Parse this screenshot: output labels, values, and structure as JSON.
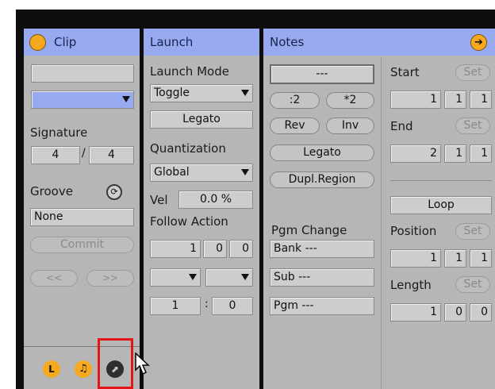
{
  "clip": {
    "title": "Clip",
    "signature_label": "Signature",
    "sig_num": "4",
    "sig_slash": "/",
    "sig_den": "4",
    "groove_label": "Groove",
    "groove_value": "None",
    "commit_label": "Commit",
    "nudge_back": "<<",
    "nudge_fwd": ">>"
  },
  "launch": {
    "title": "Launch",
    "mode_label": "Launch Mode",
    "mode_value": "Toggle",
    "legato_label": "Legato",
    "quant_label": "Quantization",
    "quant_value": "Global",
    "vel_label": "Vel",
    "vel_value": "0.0 %",
    "follow_label": "Follow Action",
    "follow_time": [
      "1",
      "0",
      "0"
    ],
    "follow_chance_a": "1",
    "follow_chance_sep": ":",
    "follow_chance_b": "0"
  },
  "notes": {
    "title": "Notes",
    "transpose_value": "---",
    "half_label": ":2",
    "double_label": "*2",
    "rev_label": "Rev",
    "inv_label": "Inv",
    "legato_label": "Legato",
    "dupl_label": "Dupl.Region",
    "pgm_change_label": "Pgm Change",
    "bank_value": "Bank ---",
    "sub_value": "Sub ---",
    "pgm_value": "Pgm ---",
    "start_label": "Start",
    "start_values": [
      "1",
      "1",
      "1"
    ],
    "end_label": "End",
    "end_values": [
      "2",
      "1",
      "1"
    ],
    "loop_label": "Loop",
    "position_label": "Position",
    "position_values": [
      "1",
      "1",
      "1"
    ],
    "length_label": "Length",
    "length_values": [
      "1",
      "0",
      "0"
    ],
    "set_label": "Set"
  },
  "footer": {
    "launch_tab_glyph": "L",
    "notes_tab_glyph": "♫",
    "envelopes_tab_glyph": "⬈"
  },
  "colors": {
    "header": "#97a9ef",
    "panel": "#b6b6b6",
    "orange": "#f6a91f",
    "highlight": "#e4141b"
  }
}
